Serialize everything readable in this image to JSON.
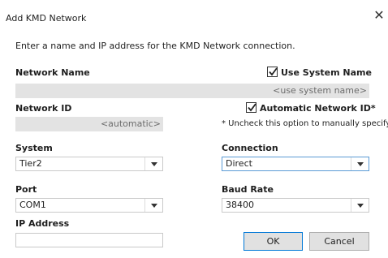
{
  "window": {
    "title": "Add KMD Network"
  },
  "instructions": "Enter a name and IP address for the KMD Network connection.",
  "network_name": {
    "label": "Network Name",
    "placeholder": "<use system name>",
    "use_system_name_label": "Use System Name",
    "use_system_name_checked": true
  },
  "network_id": {
    "label": "Network ID",
    "placeholder": "<automatic>",
    "automatic_label": "Automatic Network ID*",
    "automatic_checked": true,
    "note": "* Uncheck this option to manually specify a"
  },
  "system": {
    "label": "System",
    "value": "Tier2"
  },
  "connection": {
    "label": "Connection",
    "value": "Direct"
  },
  "port": {
    "label": "Port",
    "value": "COM1"
  },
  "baud_rate": {
    "label": "Baud Rate",
    "value": "38400"
  },
  "ip_address": {
    "label": "IP Address",
    "value": ""
  },
  "buttons": {
    "ok": "OK",
    "cancel": "Cancel"
  },
  "icons": {
    "close": "close-icon",
    "checkmark": "checkmark-icon",
    "dropdown": "chevron-down-icon"
  }
}
